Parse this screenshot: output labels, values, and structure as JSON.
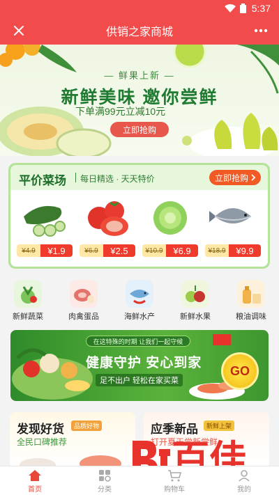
{
  "status": {
    "time": "5:37"
  },
  "appbar": {
    "title": "供销之家商城"
  },
  "banner": {
    "tag": "— 鲜果上新 —",
    "headline": "新鲜美味 邀你尝鲜",
    "subline": "下单满99元立减10元",
    "button": "立即抢购"
  },
  "pingjia": {
    "title": "平价菜场",
    "subtitle": "每日精选 · 天天特价",
    "button": "立即抢购",
    "products": [
      {
        "name": "cucumber",
        "old_price": "¥4.9",
        "price": "¥1.9"
      },
      {
        "name": "tomato",
        "old_price": "¥6.9",
        "price": "¥2.5"
      },
      {
        "name": "lettuce",
        "old_price": "¥10.9",
        "price": "¥6.9"
      },
      {
        "name": "fish",
        "old_price": "¥18.9",
        "price": "¥9.9"
      }
    ]
  },
  "categories": [
    {
      "label": "新鲜蔬菜",
      "color": "#7cc35a"
    },
    {
      "label": "肉禽蛋品",
      "color": "#e4736b"
    },
    {
      "label": "海鲜水产",
      "color": "#6ea8d8"
    },
    {
      "label": "新鲜水果",
      "color": "#9ccc4a"
    },
    {
      "label": "粮油调味",
      "color": "#f1b24a"
    }
  ],
  "promo": {
    "top_text": "在这特殊的时期 让我们一起守候",
    "slogan": "健康守护 安心到家",
    "note": "足不出户 轻松在家买菜",
    "go": "GO"
  },
  "cards": [
    {
      "title": "发现好货",
      "badge": "品质好物",
      "sub": "全民口碑推荐"
    },
    {
      "title": "应季新品",
      "badge": "新鲜上架",
      "sub": "打开夏天尝新尝鲜"
    }
  ],
  "watermark": {
    "text": "百佳"
  },
  "tabbar": [
    {
      "label": "首页",
      "icon": "home-icon"
    },
    {
      "label": "分类",
      "icon": "category-icon"
    },
    {
      "label": "购物车",
      "icon": "cart-icon"
    },
    {
      "label": "我的",
      "icon": "user-icon"
    }
  ],
  "colors": {
    "brand": "#f14b4b",
    "green": "#1f7a32",
    "price_red": "#f03a2b"
  }
}
